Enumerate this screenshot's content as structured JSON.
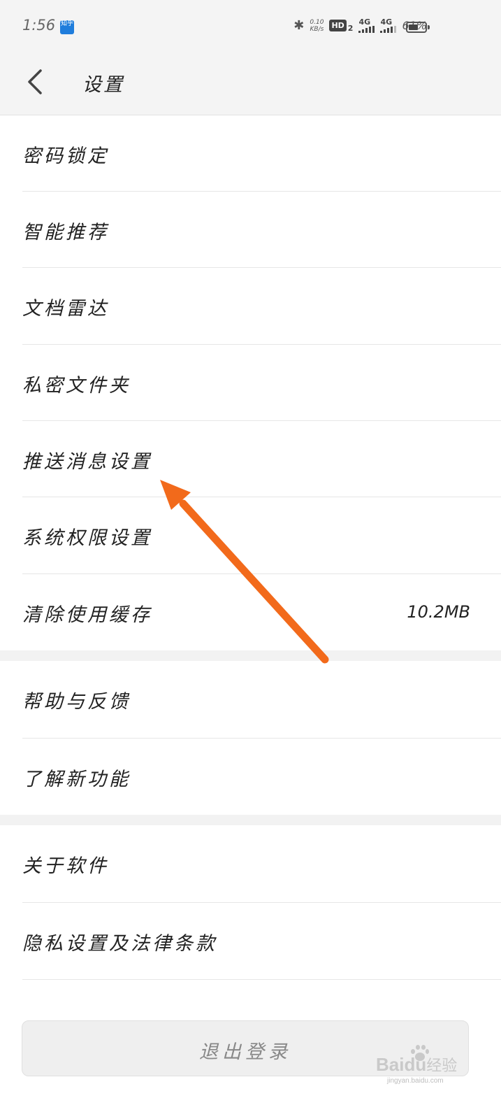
{
  "status_bar": {
    "time": "1:56",
    "app_badge": "知乎",
    "net_speed_value": "0.10",
    "net_speed_unit": "KB/s",
    "hd_label": "HD",
    "hd_sub": "2",
    "sim1_label": "4G",
    "sim2_label": "4G",
    "battery_percent": "61%",
    "battery_level": 0.61
  },
  "header": {
    "title": "设置",
    "back_icon": "chevron-left-icon"
  },
  "settings": {
    "items": [
      {
        "label": "密码锁定"
      },
      {
        "label": "智能推荐"
      },
      {
        "label": "文档雷达"
      },
      {
        "label": "私密文件夹"
      },
      {
        "label": "推送消息设置"
      },
      {
        "label": "系统权限设置"
      },
      {
        "label": "清除使用缓存",
        "value": "10.2MB"
      },
      {
        "label": "帮助与反馈"
      },
      {
        "label": "了解新功能"
      },
      {
        "label": "关于软件"
      },
      {
        "label": "隐私设置及法律条款"
      }
    ]
  },
  "logout": {
    "label": "退出登录"
  },
  "annotation": {
    "arrow_color": "#f26a1b"
  },
  "watermark": {
    "brand_a": "Bai",
    "brand_b": "du",
    "brand_cn": "经验",
    "url": "jingyan.baidu.com"
  }
}
